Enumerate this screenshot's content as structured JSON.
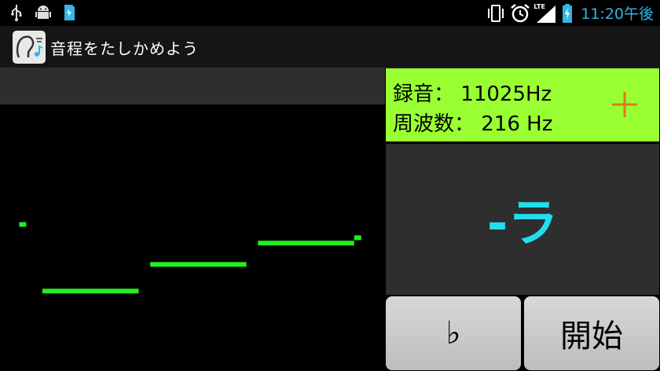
{
  "status_bar": {
    "time": "11:20午後",
    "lte_label": "LTE",
    "icons": [
      "usb-icon",
      "android-debug-icon",
      "sd-card-icon",
      "vibrate-icon",
      "alarm-icon",
      "signal-icon",
      "battery-charging-icon"
    ]
  },
  "app": {
    "title": "音程をたしかめよう"
  },
  "info": {
    "recording_label": "録音：",
    "recording_value": "11025Hz",
    "frequency_label": "周波数：",
    "frequency_value": "216 Hz",
    "plus_color": "#e07820"
  },
  "note": {
    "text": "-ラ",
    "color": "#22ddee"
  },
  "buttons": {
    "flat": "♭",
    "start": "開始"
  },
  "colors": {
    "graph_line": "#22ee22",
    "info_bg": "#99ff33"
  },
  "pitch_trace": [
    {
      "kind": "dot",
      "t": 0.06,
      "level": 0.55
    },
    {
      "kind": "segment",
      "t_start": 0.11,
      "t_end": 0.36,
      "level": 0.3
    },
    {
      "kind": "segment",
      "t_start": 0.39,
      "t_end": 0.64,
      "level": 0.4
    },
    {
      "kind": "segment",
      "t_start": 0.67,
      "t_end": 0.92,
      "level": 0.48
    },
    {
      "kind": "dot",
      "t": 0.93,
      "level": 0.5
    }
  ]
}
